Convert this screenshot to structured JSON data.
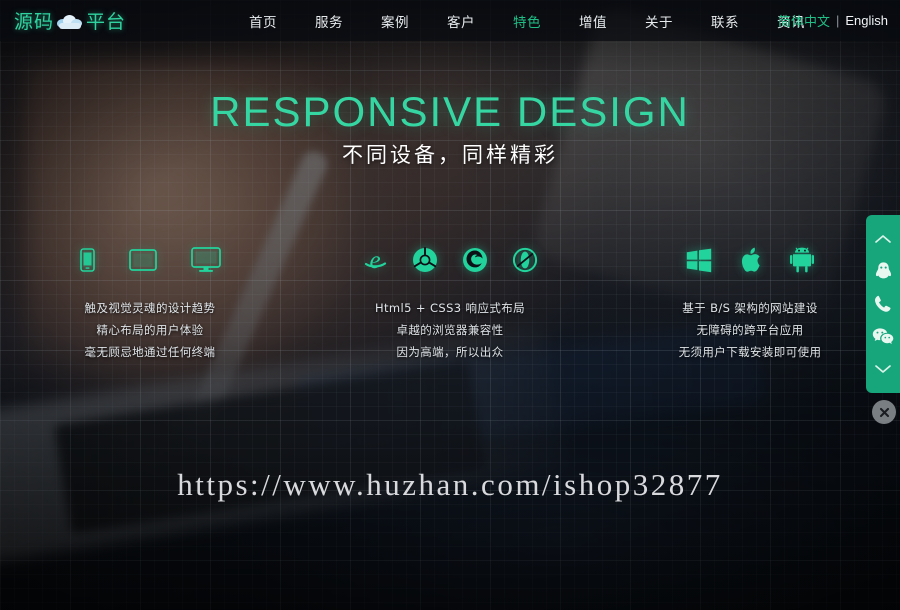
{
  "header": {
    "logo_text_left": "源码",
    "logo_text_right": "平台",
    "logo_icon": "cloud-icon",
    "nav": [
      {
        "label": "首页",
        "active": false
      },
      {
        "label": "服务",
        "active": false
      },
      {
        "label": "案例",
        "active": false
      },
      {
        "label": "客户",
        "active": false
      },
      {
        "label": "特色",
        "active": true
      },
      {
        "label": "增值",
        "active": false
      },
      {
        "label": "关于",
        "active": false
      },
      {
        "label": "联系",
        "active": false
      },
      {
        "label": "资讯",
        "active": false
      }
    ],
    "lang": {
      "chinese": "简体中文",
      "separator": "|",
      "english": "English"
    }
  },
  "hero": {
    "title": "RESPONSIVE DESIGN",
    "subtitle": "不同设备，同样精彩",
    "title_color": "#35d6a2",
    "accent_color": "#1fbf86"
  },
  "features": [
    {
      "id": "devices",
      "icons": [
        "phone-icon",
        "tablet-icon",
        "monitor-icon"
      ],
      "lines": [
        "触及视觉灵魂的设计趋势",
        "精心布局的用户体验",
        "毫无顾忌地通过任何终端"
      ]
    },
    {
      "id": "browsers",
      "icons": [
        "internet-explorer-icon",
        "chrome-icon",
        "firefox-icon",
        "opera-icon"
      ],
      "lines": [
        "Html5 + CSS3 响应式布局",
        "卓越的浏览器兼容性",
        "因为高端，所以出众"
      ]
    },
    {
      "id": "platforms",
      "icons": [
        "windows-icon",
        "apple-icon",
        "android-icon"
      ],
      "lines": [
        "基于 B/S 架构的网站建设",
        "无障碍的跨平台应用",
        "无须用户下载安装即可使用"
      ]
    }
  ],
  "watermark": {
    "text": "https://www.huzhan.com/ishop32877"
  },
  "side_panel": {
    "background_color": "#17a57c",
    "items": [
      {
        "icon": "chevron-up-icon",
        "name": "scroll-up"
      },
      {
        "icon": "qq-icon",
        "name": "qq-contact"
      },
      {
        "icon": "phone-call-icon",
        "name": "phone-contact"
      },
      {
        "icon": "wechat-icon",
        "name": "wechat-contact"
      },
      {
        "icon": "chevron-down-icon",
        "name": "scroll-down"
      }
    ],
    "close_icon": "close-icon"
  }
}
